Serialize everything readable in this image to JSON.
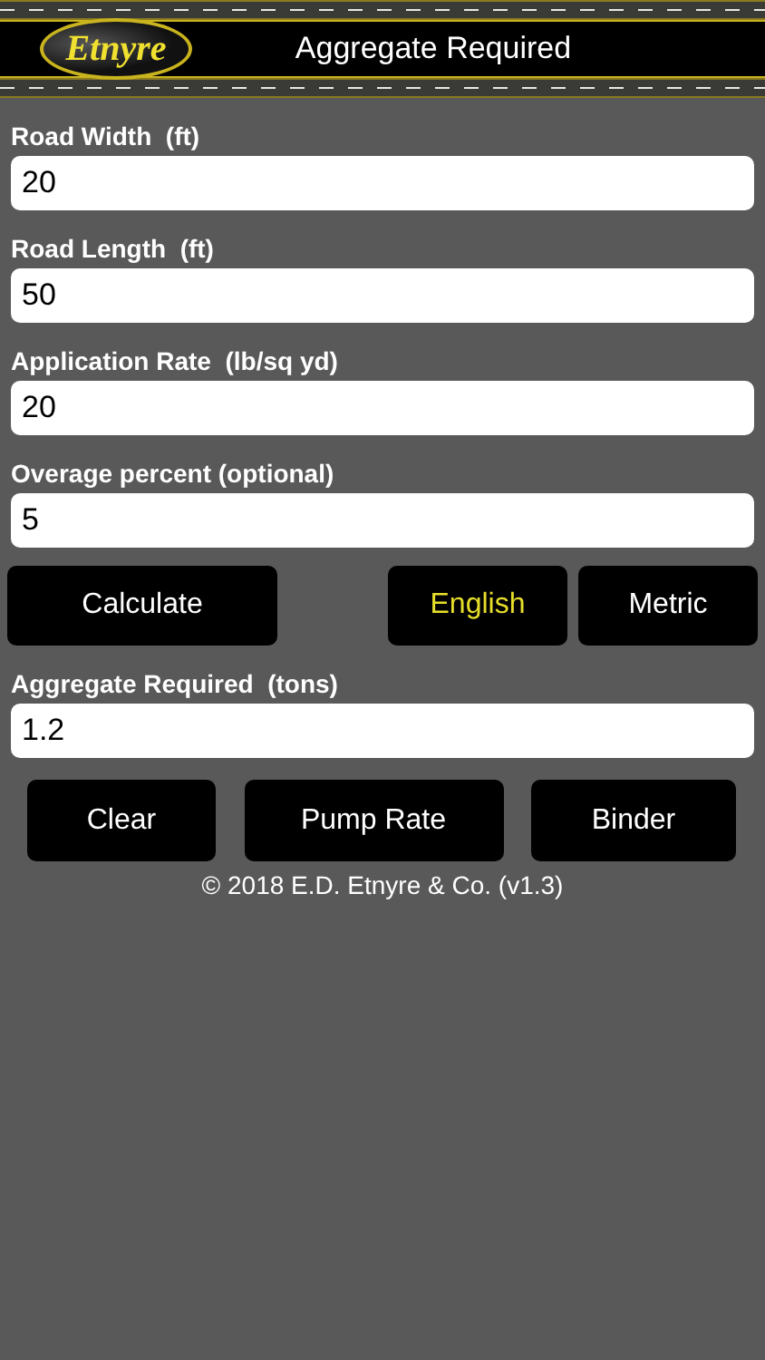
{
  "header": {
    "logo": "Etnyre",
    "title": "Aggregate Required"
  },
  "fields": [
    {
      "label": "Road Width  (ft)",
      "value": "20"
    },
    {
      "label": "Road Length  (ft)",
      "value": "50"
    },
    {
      "label": "Application Rate  (lb/sq yd)",
      "value": "20"
    },
    {
      "label": "Overage percent (optional)",
      "value": "5"
    }
  ],
  "calculate_button": "Calculate",
  "units": [
    {
      "label": "English",
      "selected": true
    },
    {
      "label": "Metric",
      "selected": false
    }
  ],
  "result": {
    "label": "Aggregate Required  (tons)",
    "value": "1.2"
  },
  "buttons": [
    "Clear",
    "Pump Rate",
    "Binder"
  ],
  "footer": "© 2018 E.D. Etnyre & Co. (v1.3)"
}
